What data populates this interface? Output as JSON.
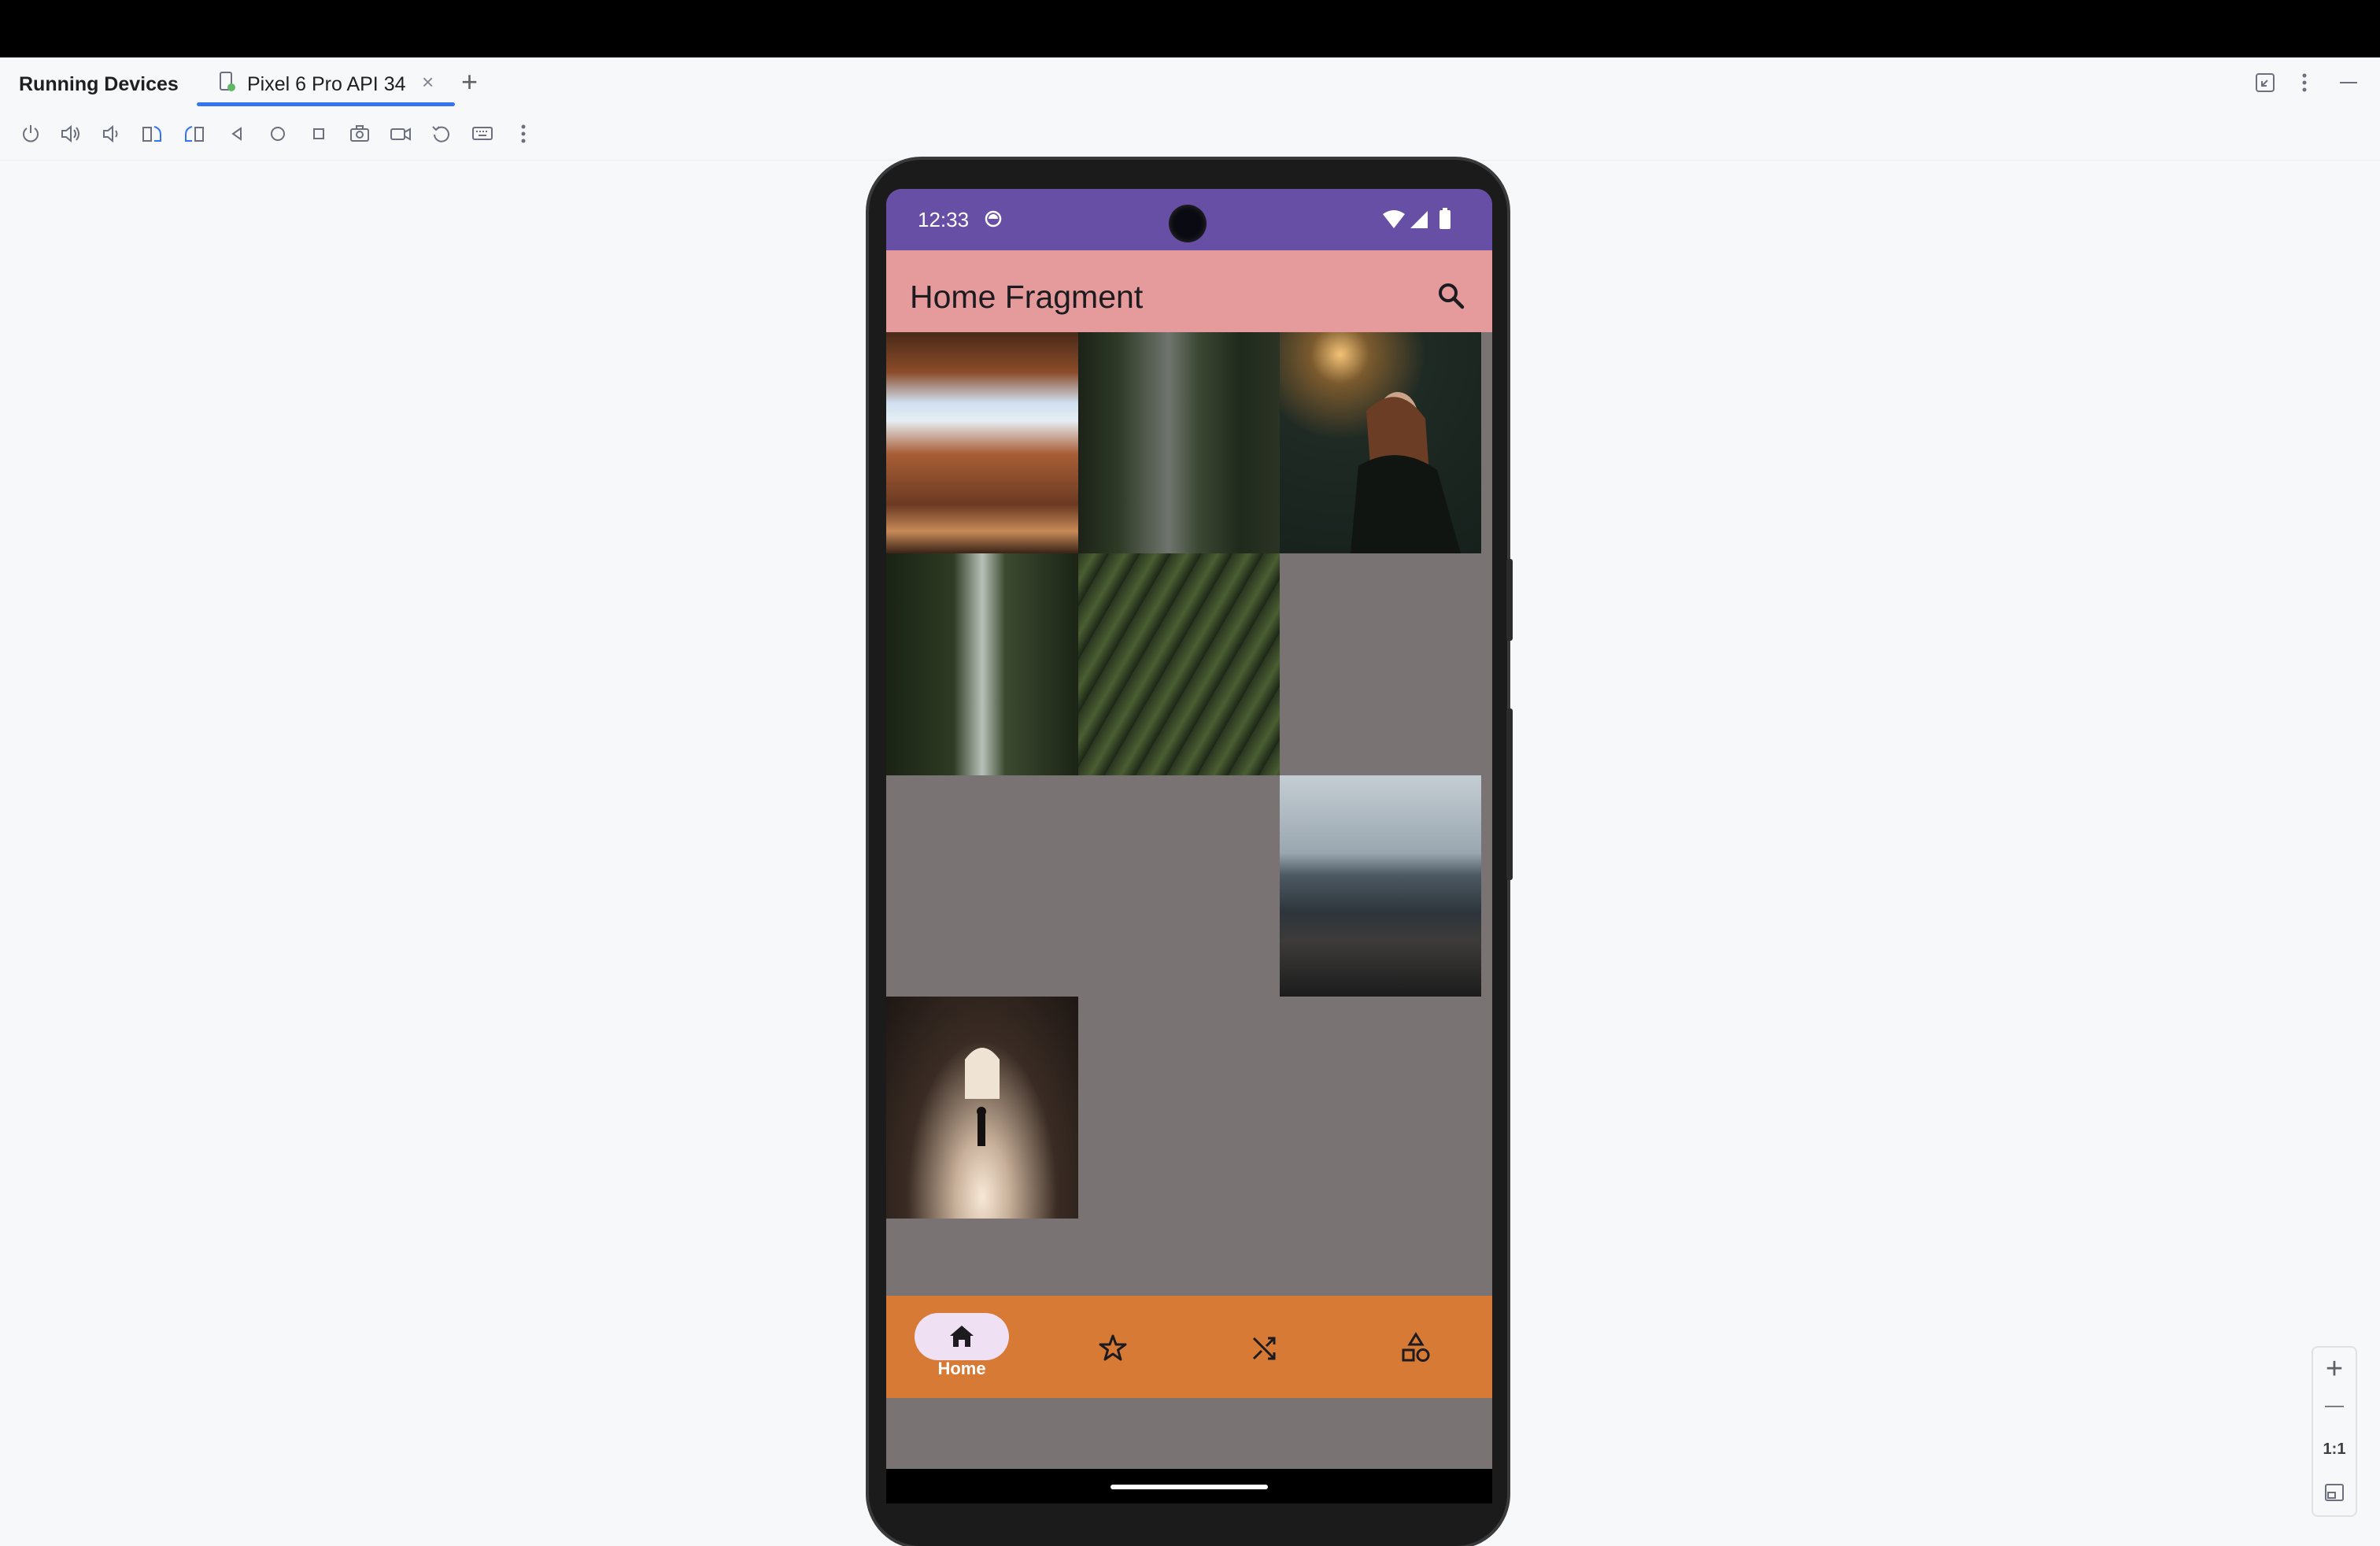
{
  "ide": {
    "tool_window_title": "Running Devices",
    "tab_label": "Pixel 6 Pro API 34",
    "tab_close": "×",
    "add_tab": "+",
    "toolbar_icons": [
      "power-icon",
      "volume-up-icon",
      "volume-down-icon",
      "rotate-left-icon",
      "rotate-right-icon",
      "back-icon",
      "home-icon",
      "overview-icon",
      "screenshot-icon",
      "screen-record-icon",
      "reset-icon",
      "keyboard-icon",
      "more-icon"
    ]
  },
  "device": {
    "status_time": "12:33",
    "app_title": "Home Fragment",
    "nav_items": [
      {
        "label": "Home",
        "icon": "home-icon",
        "selected": true
      },
      {
        "label": "",
        "icon": "star-icon",
        "selected": false
      },
      {
        "label": "",
        "icon": "shuffle-icon",
        "selected": false
      },
      {
        "label": "",
        "icon": "shapes-icon",
        "selected": false
      }
    ],
    "photos": [
      "canyon-cave",
      "pine-forest",
      "woman-tunnel",
      "waterfall",
      "green-leaf",
      "rocky-shore",
      "sunlit-hallway"
    ]
  },
  "zoom": {
    "in": "+",
    "out": "—",
    "actual": "1:1"
  },
  "colors": {
    "status_bar": "#674fa5",
    "app_bar": "#e59b9b",
    "screen_bg": "#7a7373",
    "nav_bar": "#d67a36",
    "nav_pill": "#efe0f3",
    "accent": "#3574f0"
  }
}
